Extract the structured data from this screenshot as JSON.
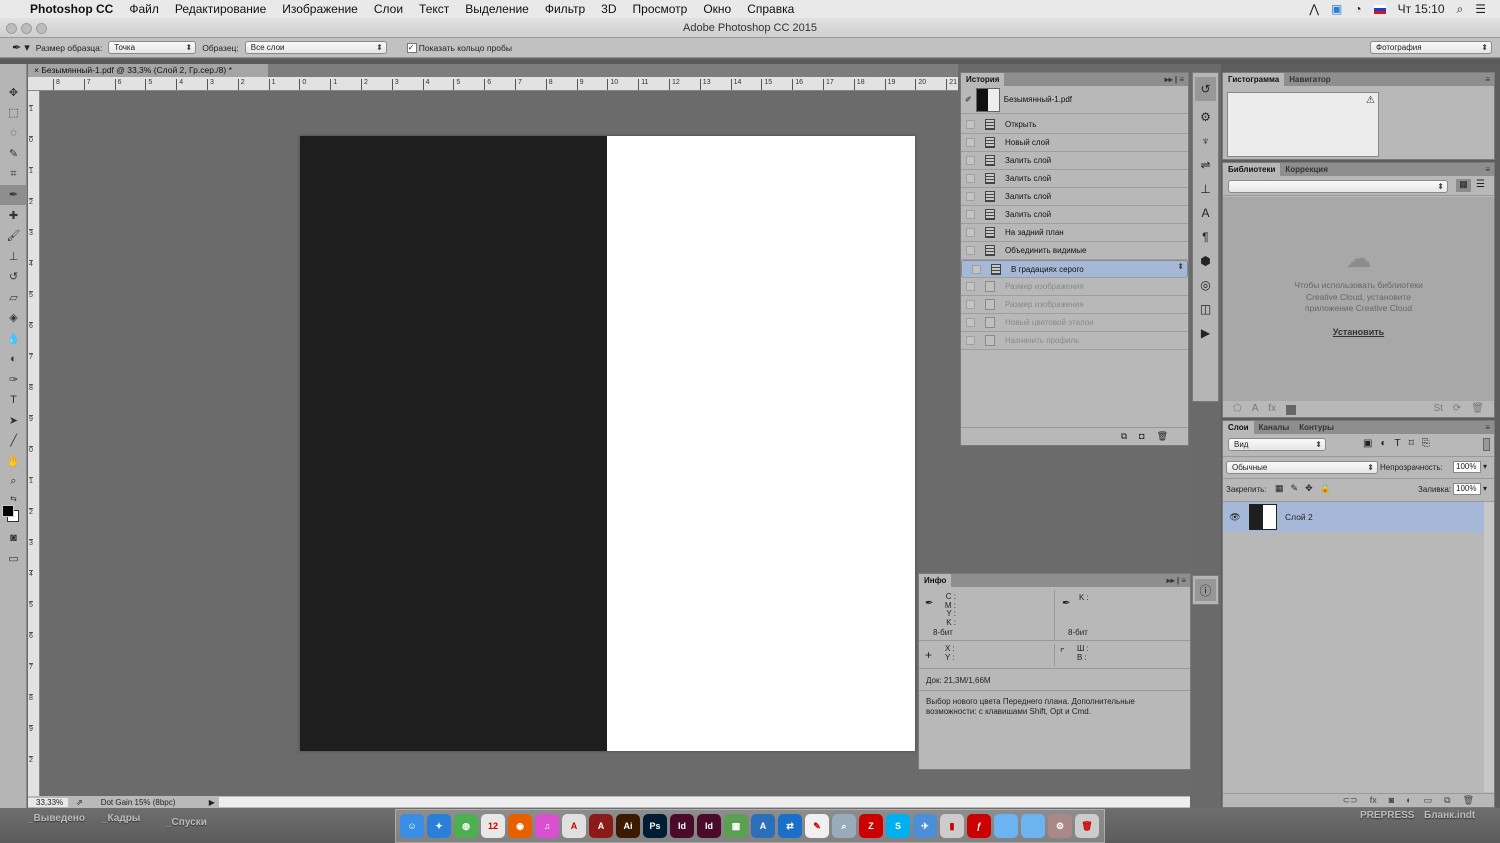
{
  "menubar": {
    "app": "Photoshop CC",
    "items": [
      "Файл",
      "Редактирование",
      "Изображение",
      "Слои",
      "Текст",
      "Выделение",
      "Фильтр",
      "3D",
      "Просмотр",
      "Окно",
      "Справка"
    ],
    "clock": "Чт 15:10"
  },
  "window": {
    "title": "Adobe Photoshop CC 2015"
  },
  "options": {
    "sample_size_label": "Размер образца:",
    "sample_size": "Точка",
    "sample_label": "Образец:",
    "sample": "Все слои",
    "show_ring": "Показать кольцо пробы",
    "workspace": "Фотография"
  },
  "document": {
    "tab": "Безымянный-1.pdf @ 33,3% (Слой 2, Гр.сер./8) *",
    "zoom": "33,33%",
    "profile": "Dot Gain 15% (8bpc)",
    "ruler_h": [
      "8",
      "7",
      "6",
      "5",
      "4",
      "3",
      "2",
      "1",
      "0",
      "1",
      "2",
      "3",
      "4",
      "5",
      "6",
      "7",
      "8",
      "9",
      "10",
      "11",
      "12",
      "13",
      "14",
      "15",
      "16",
      "17",
      "18",
      "19",
      "20",
      "21"
    ],
    "ruler_v": [
      "1",
      "0",
      "1",
      "2",
      "3",
      "4",
      "5",
      "6",
      "7",
      "8",
      "9",
      "0",
      "1",
      "2",
      "3",
      "4",
      "5",
      "6",
      "7",
      "8",
      "9",
      "2"
    ]
  },
  "history": {
    "tab": "История",
    "snapshot": "Безымянный-1.pdf",
    "items": [
      {
        "label": "Открыть",
        "state": "normal"
      },
      {
        "label": "Новый слой",
        "state": "normal"
      },
      {
        "label": "Залить слой",
        "state": "normal"
      },
      {
        "label": "Залить слой",
        "state": "normal"
      },
      {
        "label": "Залить слой",
        "state": "normal"
      },
      {
        "label": "Залить слой",
        "state": "normal"
      },
      {
        "label": "На задний план",
        "state": "normal"
      },
      {
        "label": "Объединить видимые",
        "state": "normal"
      },
      {
        "label": "В градациях серого",
        "state": "selected"
      },
      {
        "label": "Размер изображения",
        "state": "disabled"
      },
      {
        "label": "Размер изображения",
        "state": "disabled"
      },
      {
        "label": "Новый цветовой эталон",
        "state": "disabled"
      },
      {
        "label": "Назначить профиль",
        "state": "disabled"
      }
    ]
  },
  "histogram": {
    "tabs": [
      "Гистограмма",
      "Навигатор"
    ]
  },
  "libraries": {
    "tabs": [
      "Библиотеки",
      "Коррекция"
    ],
    "message": "Чтобы использовать библиотеки Creative Cloud, установите приложение Creative Cloud",
    "install": "Установить"
  },
  "layers": {
    "tabs": [
      "Слои",
      "Каналы",
      "Контуры"
    ],
    "filter": "Вид",
    "blend": "Обычные",
    "opacity_label": "Непрозрачность:",
    "opacity": "100%",
    "lock_label": "Закрепить:",
    "fill_label": "Заливка:",
    "fill": "100%",
    "items": [
      {
        "name": "Слой 2"
      }
    ]
  },
  "info": {
    "tab": "Инфо",
    "cmyk": [
      "C :",
      "M :",
      "Y :",
      "K :"
    ],
    "k": "K :",
    "bits1": "8-бит",
    "bits2": "8-бит",
    "xy": [
      "X :",
      "Y :"
    ],
    "wh": [
      "Ш :",
      "В :"
    ],
    "doc": "Док: 21,3M/1,66M",
    "hint": "Выбор нового цвета Переднего плана. Дополнительные возможности: с клавишами Shift, Opt и Cmd."
  },
  "desktop": {
    "labels": [
      "_Выведено",
      "_Кадры",
      "_Спуски",
      "PREPRESS",
      "Бланк.indt"
    ]
  },
  "dock": [
    {
      "name": "finder",
      "t": "☺",
      "c": "#3a8ee6"
    },
    {
      "name": "safari",
      "t": "✦",
      "c": "#2a7fd8"
    },
    {
      "name": "globe",
      "t": "◍",
      "c": "#4caf50"
    },
    {
      "name": "calendar",
      "t": "12",
      "c": "#e8e8e8"
    },
    {
      "name": "firefox",
      "t": "◉",
      "c": "#e66000"
    },
    {
      "name": "itunes",
      "t": "♫",
      "c": "#d94fcf"
    },
    {
      "name": "acrobat",
      "t": "A",
      "c": "#e0e0e0"
    },
    {
      "name": "acrobat-pro",
      "t": "A",
      "c": "#8b1a1a"
    },
    {
      "name": "illustrator",
      "t": "Ai",
      "c": "#3b1a00"
    },
    {
      "name": "photoshop",
      "t": "Ps",
      "c": "#001d33"
    },
    {
      "name": "indesign",
      "t": "Id",
      "c": "#4a0a2a"
    },
    {
      "name": "indesign-2",
      "t": "Id",
      "c": "#4a0a2a"
    },
    {
      "name": "maps",
      "t": "▦",
      "c": "#5aa050"
    },
    {
      "name": "fontbook",
      "t": "A",
      "c": "#2a6fb8"
    },
    {
      "name": "teamviewer",
      "t": "⇄",
      "c": "#1a6fc8"
    },
    {
      "name": "textedit",
      "t": "✎",
      "c": "#f0f0f0"
    },
    {
      "name": "preview",
      "t": "⌕",
      "c": "#9ab"
    },
    {
      "name": "filezilla",
      "t": "Z",
      "c": "#c00"
    },
    {
      "name": "skype",
      "t": "S",
      "c": "#00aff0"
    },
    {
      "name": "airmail",
      "t": "✈",
      "c": "#4a8fd8"
    },
    {
      "name": "chart",
      "t": "▮",
      "c": "#ccc"
    },
    {
      "name": "flash",
      "t": "ƒ",
      "c": "#c00"
    },
    {
      "name": "folder",
      "t": "",
      "c": "#6db3f2"
    },
    {
      "name": "folder-2",
      "t": "",
      "c": "#6db3f2"
    },
    {
      "name": "scripteditor",
      "t": "⚙",
      "c": "#a88"
    },
    {
      "name": "trash",
      "t": "🗑",
      "c": "#ccc"
    }
  ]
}
